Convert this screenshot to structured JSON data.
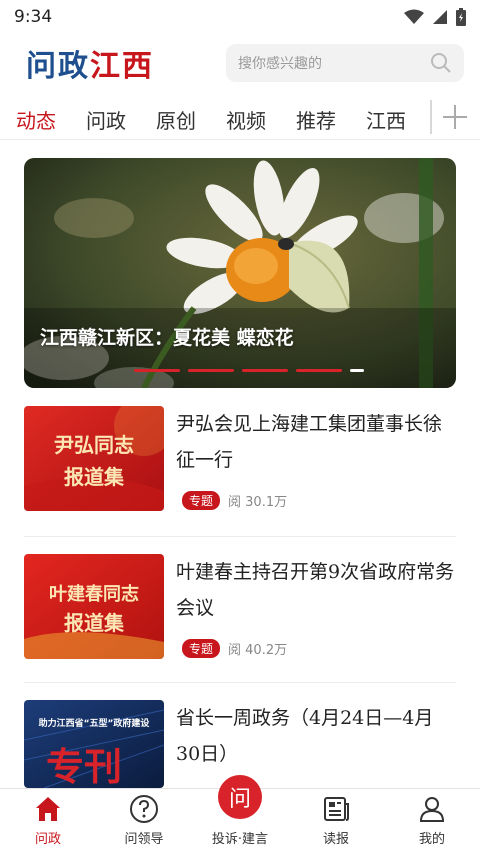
{
  "status": {
    "time": "9:34"
  },
  "header": {
    "logo_part1": "问政",
    "logo_part2": "江西",
    "search_placeholder": "搜你感兴趣的"
  },
  "tabs": [
    {
      "label": "动态",
      "active": true
    },
    {
      "label": "问政",
      "active": false
    },
    {
      "label": "原创",
      "active": false
    },
    {
      "label": "视频",
      "active": false
    },
    {
      "label": "推荐",
      "active": false
    },
    {
      "label": "江西",
      "active": false
    }
  ],
  "banner": {
    "caption": "江西赣江新区：夏花美 蝶恋花",
    "slide_count": 4,
    "current_slide": 4
  },
  "news": [
    {
      "title": "尹弘会见上海建工集团董事长徐征一行",
      "thumb_text_1": "尹弘同志",
      "thumb_text_2": "报道集",
      "tag": "专题",
      "reads": "阅 30.1万"
    },
    {
      "title": "叶建春主持召开第9次省政府常务会议",
      "thumb_text_1": "叶建春同志",
      "thumb_text_2": "报道集",
      "tag": "专题",
      "reads": "阅 40.2万"
    },
    {
      "title": "省长一周政务（4月24日—4月30日）",
      "thumb_text_1": "助力江西省“五型”政府建设",
      "thumb_text_2": "专刊",
      "tag": "",
      "reads": ""
    }
  ],
  "bottom_nav": [
    {
      "label": "问政",
      "icon": "home-icon",
      "active": true
    },
    {
      "label": "问领导",
      "icon": "question-icon",
      "active": false
    },
    {
      "label": "投诉·建言",
      "icon": "ask-icon",
      "center_glyph": "问",
      "active": false
    },
    {
      "label": "读报",
      "icon": "newspaper-icon",
      "active": false
    },
    {
      "label": "我的",
      "icon": "user-icon",
      "active": false
    }
  ],
  "colors": {
    "brand_red": "#c8161d",
    "brand_blue": "#1f4f8f"
  }
}
